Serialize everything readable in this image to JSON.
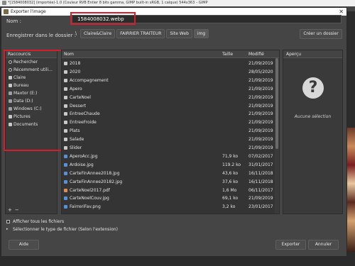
{
  "gimp": {
    "window_title": "*[1584008032] (importée)-1.0 (Couleur RVB Entier 8 bits gamma, GIMP built-in sRGB, 1 calque) 544x363 – GIMP"
  },
  "dialog": {
    "title": "Exporter l'image",
    "close_glyph": "✕",
    "name_label": "Nom :",
    "name_value": "1584008032.webp",
    "save_in_label": "Enregistrer dans le dossier :",
    "path_arrow": "\\",
    "path": [
      "Claire&Claire",
      "FAIRRIER TRAITEUR",
      "Site Web",
      "img"
    ],
    "create_folder_label": "Créer un dossier"
  },
  "places": {
    "header": "Raccourcis",
    "items": [
      {
        "label": "Rechercher",
        "icon": "search-icon"
      },
      {
        "label": "Récemment utili...",
        "icon": "recent-icon"
      },
      {
        "label": "Claire",
        "icon": "folder-icon"
      },
      {
        "label": "Bureau",
        "icon": "folder-icon"
      },
      {
        "label": "Maxtor (E:)",
        "icon": "drive-icon"
      },
      {
        "label": "Data (D:)",
        "icon": "drive-icon"
      },
      {
        "label": "Windows (C:)",
        "icon": "drive-icon"
      },
      {
        "label": "Pictures",
        "icon": "folder-icon"
      },
      {
        "label": "Documents",
        "icon": "folder-icon"
      }
    ],
    "add_glyph": "+",
    "remove_glyph": "−"
  },
  "files": {
    "columns": {
      "name": "Nom",
      "size": "Taille",
      "modified": "Modifié"
    },
    "rows": [
      {
        "name": "2018",
        "size": "",
        "modified": "21/09/2019",
        "kind": "folder"
      },
      {
        "name": "2020",
        "size": "",
        "modified": "28/05/2020",
        "kind": "folder"
      },
      {
        "name": "Accompagnement",
        "size": "",
        "modified": "21/09/2019",
        "kind": "folder"
      },
      {
        "name": "Apero",
        "size": "",
        "modified": "21/09/2019",
        "kind": "folder"
      },
      {
        "name": "CarteNoel",
        "size": "",
        "modified": "21/09/2019",
        "kind": "folder"
      },
      {
        "name": "Dessert",
        "size": "",
        "modified": "21/09/2019",
        "kind": "folder"
      },
      {
        "name": "EntreeChaude",
        "size": "",
        "modified": "21/09/2019",
        "kind": "folder"
      },
      {
        "name": "EntreeFroide",
        "size": "",
        "modified": "21/09/2019",
        "kind": "folder"
      },
      {
        "name": "Plats",
        "size": "",
        "modified": "21/09/2019",
        "kind": "folder"
      },
      {
        "name": "Salade",
        "size": "",
        "modified": "21/09/2019",
        "kind": "folder"
      },
      {
        "name": "Slider",
        "size": "",
        "modified": "21/09/2019",
        "kind": "folder"
      },
      {
        "name": "AperoAcc.jpg",
        "size": "71,9 ko",
        "modified": "07/02/2017",
        "kind": "image"
      },
      {
        "name": "Ardoise.jpg",
        "size": "119.2 ko",
        "modified": "31/01/2017",
        "kind": "image"
      },
      {
        "name": "CarteFinAnnee2018.jpg",
        "size": "43,6 ko",
        "modified": "16/11/2018",
        "kind": "image"
      },
      {
        "name": "CarteFinAnnee20182.jpg",
        "size": "37,6 ko",
        "modified": "16/11/2018",
        "kind": "image"
      },
      {
        "name": "CarteNoel2017.pdf",
        "size": "1,6 Mo",
        "modified": "06/11/2017",
        "kind": "pdf"
      },
      {
        "name": "CarteNoelCouv.jpg",
        "size": "69,1 ko",
        "modified": "21/09/2019",
        "kind": "image"
      },
      {
        "name": "FairreriFav.png",
        "size": "3,2 ko",
        "modified": "23/01/2017",
        "kind": "image"
      }
    ]
  },
  "preview": {
    "header": "Aperçu",
    "icon_glyph": "?",
    "no_selection": "Aucune sélection"
  },
  "options": {
    "show_all_files": "Afficher tous les fichiers",
    "select_file_type": "Sélectionner le type de fichier (Selon l'extension)",
    "expander_glyph": "▸"
  },
  "buttons": {
    "help": "Aide",
    "export": "Exporter",
    "cancel": "Annuler"
  }
}
